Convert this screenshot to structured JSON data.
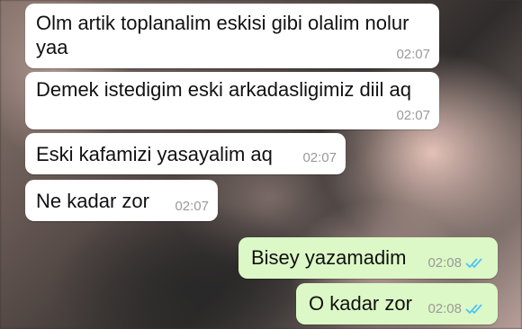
{
  "messages": [
    {
      "direction": "incoming",
      "lines": [
        "Olm artik toplanalim eskisi gibi olalim nolur",
        "yaa"
      ],
      "time": "02:07"
    },
    {
      "direction": "incoming",
      "lines": [
        "Demek istedigim eski arkadasligimiz diil aq"
      ],
      "time": "02:07"
    },
    {
      "direction": "incoming",
      "lines": [
        "Eski kafamizi yasayalim aq"
      ],
      "time": "02:07"
    },
    {
      "direction": "incoming",
      "lines": [
        "Ne kadar zor"
      ],
      "time": "02:07"
    },
    {
      "direction": "outgoing",
      "lines": [
        "Bisey yazamadim"
      ],
      "time": "02:08",
      "status": "read-double-check-icon"
    },
    {
      "direction": "outgoing",
      "lines": [
        "O kadar zor"
      ],
      "time": "02:08",
      "status": "read-double-check-icon"
    }
  ],
  "colors": {
    "incoming_bubble": "#ffffff",
    "outgoing_bubble": "#dcf8c6",
    "read_ticks": "#4fc3f7",
    "timestamp": "#9a9a9a"
  }
}
